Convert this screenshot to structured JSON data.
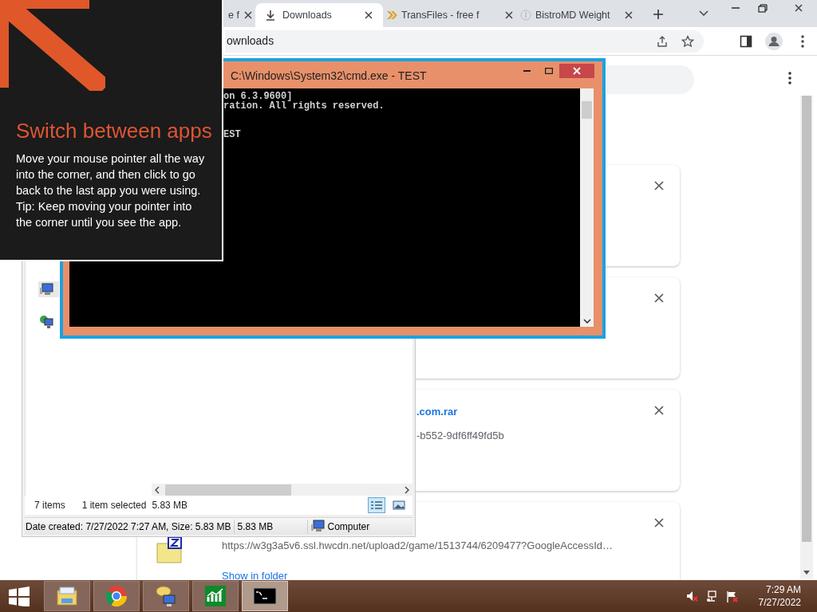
{
  "browser": {
    "tabs": [
      {
        "title": "e f",
        "kind": "page",
        "selected": false
      },
      {
        "title": "Downloads",
        "kind": "downloads",
        "selected": true
      },
      {
        "title": "TransFiles - free f",
        "kind": "transfiles",
        "selected": false
      },
      {
        "title": "BistroMD Weight",
        "kind": "bistro",
        "selected": false
      }
    ],
    "address": "ownloads",
    "download_cards": [
      {
        "file_name": ".com.rar",
        "source": "-b552-9df6ff49fd5b"
      },
      {
        "kind": "zip",
        "source": "https://w3g3a5v6.ssl.hwcdn.net/upload2/game/1513744/6209477?GoogleAccessId…",
        "action": "Show in folder"
      }
    ]
  },
  "explorer": {
    "nav_items": [
      {
        "kind": "computer",
        "selected": true
      },
      {
        "kind": "network",
        "selected": false
      }
    ],
    "item_count": "7 items",
    "selection": "1 item selected",
    "selection_size": "5.83 MB",
    "views": [
      {
        "kind": "details",
        "selected": true
      },
      {
        "kind": "thumbnails",
        "selected": false
      }
    ],
    "details": "Date created: 7/27/2022 7:27 AM, Size: 5.83 MB",
    "size": "5.83 MB",
    "zone": "Computer"
  },
  "console": {
    "title": "C:\\Windows\\System32\\cmd.exe - TEST",
    "lines": [
      "on 6.3.9600]",
      "ration. All rights reserved."
    ],
    "prompt_line": "EST"
  },
  "tip": {
    "title": "Switch between apps",
    "paragraphs": [
      "Move your mouse pointer all the way into the corner, and then click to go back to the last app you were using.",
      "Tip: Keep moving your pointer into the corner until you see the app."
    ]
  },
  "taskbar": {
    "apps": [
      {
        "kind": "explorer",
        "selected": false
      },
      {
        "kind": "chrome",
        "selected": false
      },
      {
        "kind": "network",
        "selected": false
      },
      {
        "kind": "chart",
        "selected": false
      },
      {
        "kind": "cmd",
        "selected": true
      }
    ],
    "time": "7:29 AM",
    "date": "7/27/2022"
  }
}
